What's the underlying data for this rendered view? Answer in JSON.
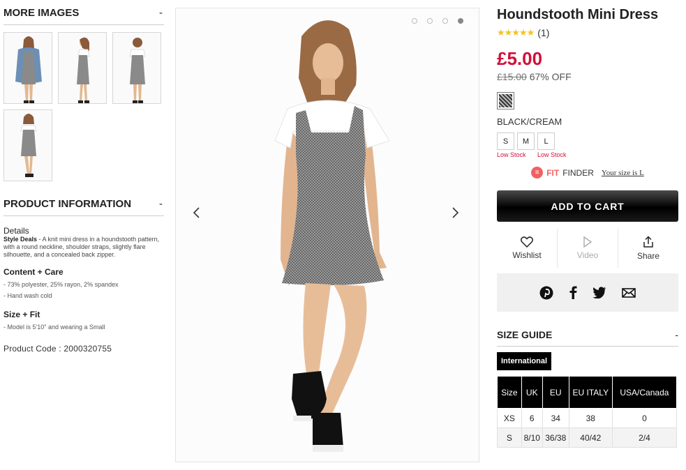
{
  "left": {
    "more_images_title": "MORE IMAGES",
    "collapse_symbol": "-",
    "product_info_title": "PRODUCT INFORMATION",
    "details_title": "Details",
    "details_lead": "Style Deals",
    "details_text": " - A knit mini dress in a houndstooth pattern, with a round neckline, shoulder straps, slightly flare silhouette, and a concealed back zipper.",
    "content_care_title": "Content + Care",
    "content_care_lines": [
      "- 73% polyester, 25% rayon, 2% spandex",
      "- Hand wash cold"
    ],
    "size_fit_title": "Size + Fit",
    "size_fit_lines": [
      "- Model is 5'10\" and wearing a Small"
    ],
    "product_code": "Product Code : 2000320755"
  },
  "gallery": {
    "active_dot": 4,
    "prev_arrow": "‹",
    "next_arrow": "›"
  },
  "product": {
    "title": "Houndstooth Mini Dress",
    "stars": "★★★★★",
    "review_count": "(1)",
    "price": "£5.00",
    "was_price": "£15.00",
    "discount": " 67% OFF",
    "color_name": "BLACK/CREAM",
    "sizes": [
      {
        "label": "S",
        "low": "Low Stock"
      },
      {
        "label": "M",
        "low": ""
      },
      {
        "label": "L",
        "low": "Low Stock"
      }
    ],
    "fit_logo": "≡",
    "fit_bold": "FIT",
    "fit_finder": "FINDER",
    "your_size": "Your size is L",
    "add_to_cart": "ADD TO CART",
    "actions": {
      "wishlist": "Wishlist",
      "video": "Video",
      "share": "Share"
    }
  },
  "size_guide": {
    "title": "SIZE GUIDE",
    "collapse_symbol": "-",
    "tab": "International",
    "headers": [
      "Size",
      "UK",
      "EU",
      "EU ITALY",
      "USA/Canada"
    ],
    "rows": [
      [
        "XS",
        "6",
        "34",
        "38",
        "0"
      ],
      [
        "S",
        "8/10",
        "36/38",
        "40/42",
        "2/4"
      ]
    ]
  },
  "colors": {
    "price_red": "#d0103a",
    "star_yellow": "#f2c41f",
    "fit_finder_coral": "#f06262"
  }
}
